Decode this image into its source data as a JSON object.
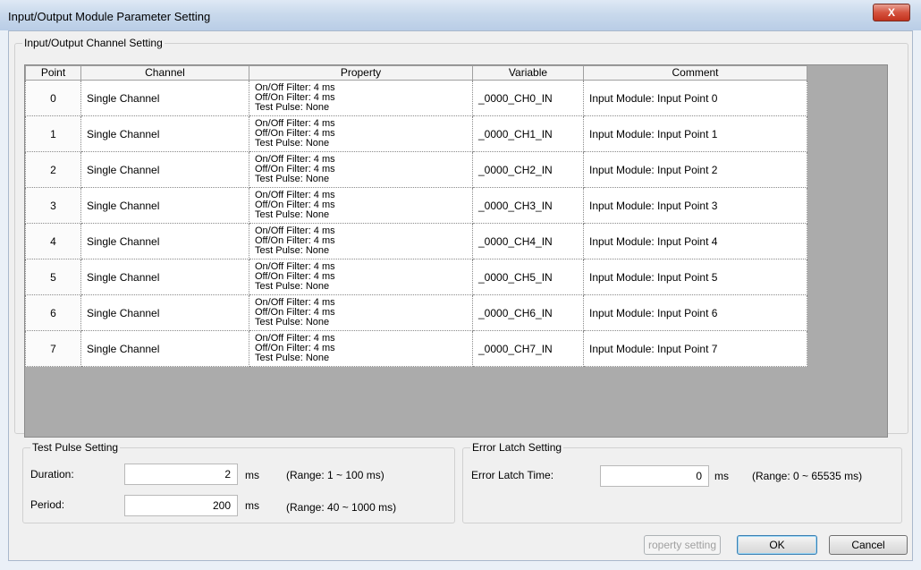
{
  "window": {
    "title": "Input/Output Module Parameter Setting",
    "close_glyph": "X"
  },
  "channel_setting": {
    "legend": "Input/Output Channel Setting",
    "columns": [
      "Point",
      "Channel",
      "Property",
      "Variable",
      "Comment"
    ],
    "rows": [
      {
        "point": "0",
        "channel": "Single Channel",
        "prop1": "On/Off Filter: 4 ms",
        "prop2": "Off/On Filter: 4 ms",
        "prop3": "Test Pulse: None",
        "variable": "_0000_CH0_IN",
        "comment": "Input Module: Input Point 0"
      },
      {
        "point": "1",
        "channel": "Single Channel",
        "prop1": "On/Off Filter: 4 ms",
        "prop2": "Off/On Filter: 4 ms",
        "prop3": "Test Pulse: None",
        "variable": "_0000_CH1_IN",
        "comment": "Input Module: Input Point 1"
      },
      {
        "point": "2",
        "channel": "Single Channel",
        "prop1": "On/Off Filter: 4 ms",
        "prop2": "Off/On Filter: 4 ms",
        "prop3": "Test Pulse: None",
        "variable": "_0000_CH2_IN",
        "comment": "Input Module: Input Point 2"
      },
      {
        "point": "3",
        "channel": "Single Channel",
        "prop1": "On/Off Filter: 4 ms",
        "prop2": "Off/On Filter: 4 ms",
        "prop3": "Test Pulse: None",
        "variable": "_0000_CH3_IN",
        "comment": "Input Module: Input Point 3"
      },
      {
        "point": "4",
        "channel": "Single Channel",
        "prop1": "On/Off Filter: 4 ms",
        "prop2": "Off/On Filter: 4 ms",
        "prop3": "Test Pulse: None",
        "variable": "_0000_CH4_IN",
        "comment": "Input Module: Input Point 4"
      },
      {
        "point": "5",
        "channel": "Single Channel",
        "prop1": "On/Off Filter: 4 ms",
        "prop2": "Off/On Filter: 4 ms",
        "prop3": "Test Pulse: None",
        "variable": "_0000_CH5_IN",
        "comment": "Input Module: Input Point 5"
      },
      {
        "point": "6",
        "channel": "Single Channel",
        "prop1": "On/Off Filter: 4 ms",
        "prop2": "Off/On Filter: 4 ms",
        "prop3": "Test Pulse: None",
        "variable": "_0000_CH6_IN",
        "comment": "Input Module: Input Point 6"
      },
      {
        "point": "7",
        "channel": "Single Channel",
        "prop1": "On/Off Filter: 4 ms",
        "prop2": "Off/On Filter: 4 ms",
        "prop3": "Test Pulse: None",
        "variable": "_0000_CH7_IN",
        "comment": "Input Module: Input Point 7"
      }
    ]
  },
  "test_pulse": {
    "legend": "Test Pulse Setting",
    "duration_label": "Duration:",
    "duration_value": "2",
    "duration_unit": "ms",
    "duration_range": "(Range: 1 ~ 100 ms)",
    "period_label": "Period:",
    "period_value": "200",
    "period_unit": "ms",
    "period_range": "(Range: 40 ~ 1000 ms)"
  },
  "error_latch": {
    "legend": "Error Latch Setting",
    "time_label": "Error Latch Time:",
    "time_value": "0",
    "time_unit": "ms",
    "time_range": "(Range: 0 ~ 65535 ms)"
  },
  "buttons": {
    "property_setting": "roperty setting",
    "ok": "OK",
    "cancel": "Cancel"
  }
}
